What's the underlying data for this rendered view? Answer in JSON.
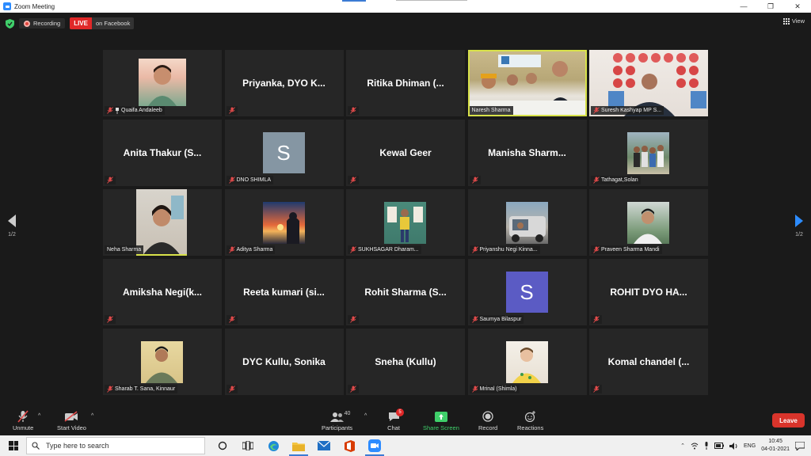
{
  "window": {
    "title": "Zoom Meeting",
    "minimize": "—",
    "restore": "❐",
    "close": "✕"
  },
  "status": {
    "recording_label": "Recording",
    "live_label": "LIVE",
    "live_platform": "on Facebook",
    "view_label": "View"
  },
  "navigation": {
    "page_left": "1/2",
    "page_right": "1/2"
  },
  "participants": [
    {
      "name": "Quaifa Andaleeb",
      "video": true,
      "pinned": true
    },
    {
      "name": "Priyanka, DYO K...",
      "video": false
    },
    {
      "name": "Ritika Dhiman (...",
      "video": false
    },
    {
      "name": "Naresh Sharma",
      "video": true,
      "active": true
    },
    {
      "name": "Suresh Kashyap MP S...",
      "video": true
    },
    {
      "name": "Anita Thakur (S...",
      "video": false
    },
    {
      "name": "DNO SHIMLA",
      "video": false,
      "avatar_letter": "S",
      "avatar_color": "#8596a3"
    },
    {
      "name": "Kewal Geer",
      "video": false
    },
    {
      "name": "Manisha Sharm...",
      "video": false
    },
    {
      "name": "Tathagat,Solan",
      "video": true
    },
    {
      "name": "Neha Sharma",
      "video": true
    },
    {
      "name": "Aditya Sharma",
      "video": true
    },
    {
      "name": "SUKHSAGAR Dharam...",
      "video": true
    },
    {
      "name": "Priyanshu Negi Kinna...",
      "video": true
    },
    {
      "name": "Praveen Sharma Mandi",
      "video": true
    },
    {
      "name": "Amiksha Negi(k...",
      "video": false
    },
    {
      "name": "Reeta kumari (si...",
      "video": false
    },
    {
      "name": "Rohit Sharma (S...",
      "video": false
    },
    {
      "name": "Saumya Bilaspur",
      "video": false,
      "avatar_letter": "S",
      "avatar_color": "#5b5bc4"
    },
    {
      "name": "ROHIT DYO HA...",
      "video": false
    },
    {
      "name": "Sharab T. Sana, Kinnaur",
      "video": true
    },
    {
      "name": "DYC Kullu, Sonika",
      "video": false
    },
    {
      "name": "Sneha (Kullu)",
      "video": false
    },
    {
      "name": "Mrinal (Shimla)",
      "video": true
    },
    {
      "name": "Komal chandel (...",
      "video": false
    }
  ],
  "toolbar": {
    "unmute": "Unmute",
    "start_video": "Start Video",
    "participants": "Participants",
    "participants_count": "40",
    "chat": "Chat",
    "chat_badge": "5",
    "share_screen": "Share Screen",
    "record": "Record",
    "reactions": "Reactions",
    "leave": "Leave"
  },
  "taskbar": {
    "search_placeholder": "Type here to search",
    "language": "ENG",
    "time": "10:45",
    "date": "04-01-2021"
  },
  "colors": {
    "accent": "#2d8cff",
    "live_red": "#e02828",
    "leave_red": "#d9342b",
    "share_green": "#3fcf6a",
    "active_border": "#d8e24a"
  }
}
